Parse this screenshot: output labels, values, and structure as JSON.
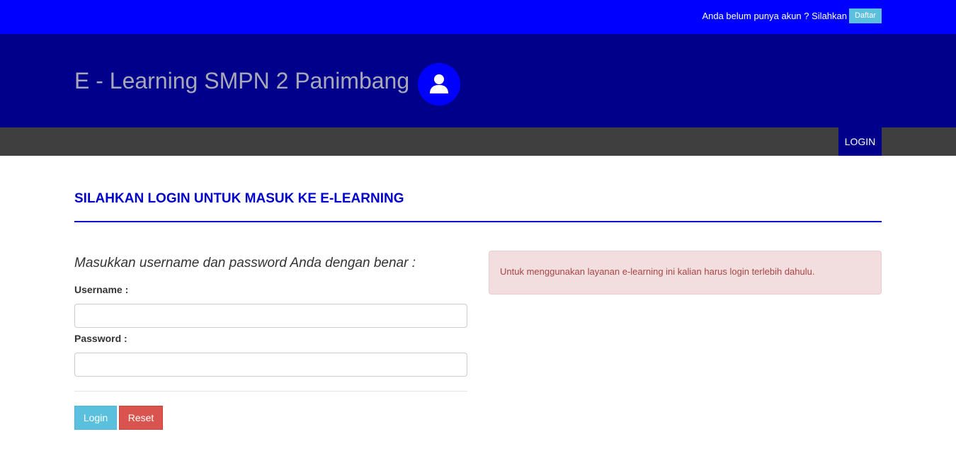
{
  "topbar": {
    "prompt": "Anda belum punya akun ? Silahkan",
    "register_label": "Daftar"
  },
  "header": {
    "title": "E - Learning SMPN 2 Panimbang",
    "avatar_icon": "user-icon"
  },
  "nav": {
    "items": [
      {
        "label": "LOGIN",
        "active": true
      }
    ]
  },
  "main": {
    "heading": "SILAHKAN LOGIN UNTUK MASUK KE E-LEARNING",
    "form": {
      "instruction": "Masukkan username dan password Anda dengan benar :",
      "username_label": "Username :",
      "username_value": "",
      "password_label": "Password :",
      "password_value": "",
      "login_button": "Login",
      "reset_button": "Reset"
    },
    "alert": {
      "text": "Untuk menggunakan layanan e-learning ini kalian harus login terlebih dahulu."
    }
  },
  "colors": {
    "topbar": "#0000ff",
    "header": "#00008b",
    "navbar": "#3f3f3f",
    "accent": "#0000cc",
    "info": "#5bc0de",
    "danger": "#d9534f",
    "alert_bg": "#f2dede",
    "alert_text": "#a94442"
  }
}
